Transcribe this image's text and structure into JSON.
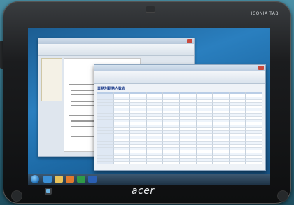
{
  "device": {
    "brand": "acer",
    "model_label": "ICONIA TAB"
  },
  "screen": {
    "documents": {
      "spreadsheet_title": "業務別勤務人数表"
    }
  },
  "colors": {
    "desktop": "#2a7fbf",
    "bezel": "#111213",
    "taskbar": "#2a4258"
  },
  "icons": [
    "start-orb-icon",
    "ie-icon",
    "folder-icon",
    "media-icon",
    "excel-icon",
    "word-icon"
  ]
}
